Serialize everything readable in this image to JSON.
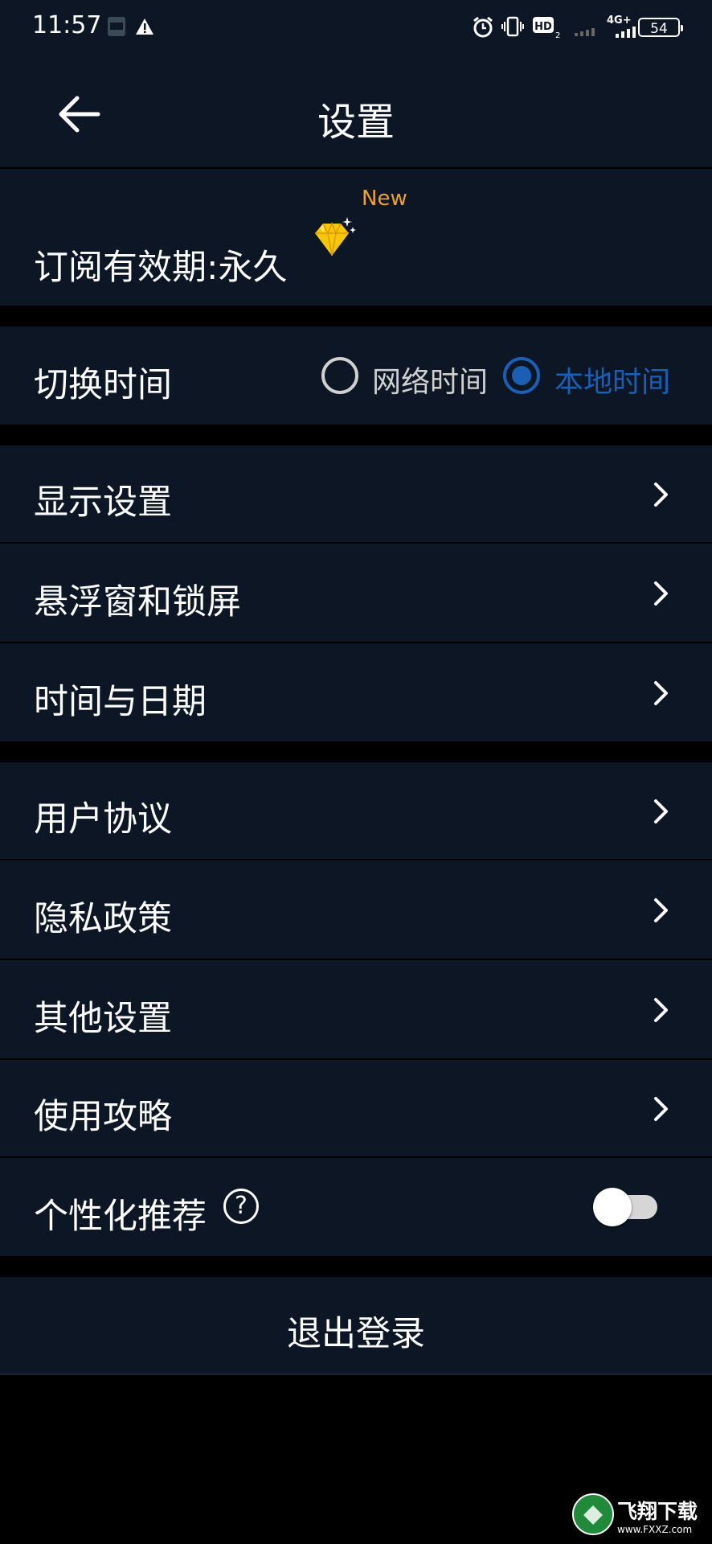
{
  "status_bar": {
    "time": "11:57",
    "network": "4G+",
    "hd": "HD",
    "battery": "54"
  },
  "header": {
    "title": "设置"
  },
  "subscription": {
    "label": "订阅有效期:永久",
    "badge": "New",
    "icon": "diamond-icon"
  },
  "time_switch": {
    "label": "切换时间",
    "options": [
      {
        "label": "网络时间",
        "selected": false
      },
      {
        "label": "本地时间",
        "selected": true
      }
    ],
    "accent": "#1a5fb4"
  },
  "group1": [
    {
      "label": "显示设置"
    },
    {
      "label": "悬浮窗和锁屏"
    },
    {
      "label": "时间与日期"
    }
  ],
  "group2": [
    {
      "label": "用户协议"
    },
    {
      "label": "隐私政策"
    },
    {
      "label": "其他设置"
    },
    {
      "label": "使用攻略"
    }
  ],
  "personalized": {
    "label": "个性化推荐",
    "help": "?",
    "enabled": false
  },
  "logout": {
    "label": "退出登录"
  },
  "watermark": {
    "brand": "飞翔下载",
    "url": "www.FXXZ.com"
  }
}
